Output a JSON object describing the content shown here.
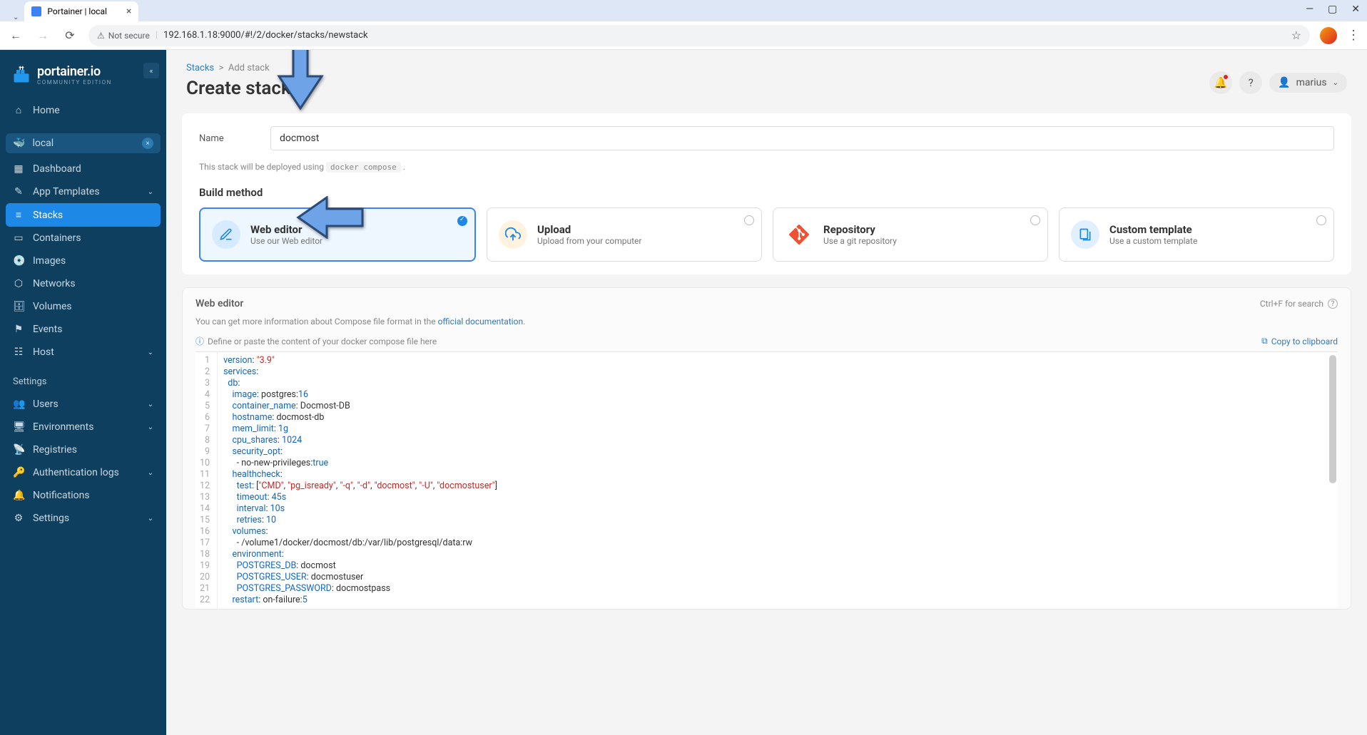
{
  "browser": {
    "tab_title": "Portainer | local",
    "security_label": "Not secure",
    "url": "192.168.1.18:9000/#!/2/docker/stacks/newstack"
  },
  "sidebar": {
    "logo": "portainer.io",
    "logo_sub": "COMMUNITY EDITION",
    "home": "Home",
    "env_label": "local",
    "items": [
      "Dashboard",
      "App Templates",
      "Stacks",
      "Containers",
      "Images",
      "Networks",
      "Volumes",
      "Events",
      "Host"
    ],
    "settings_label": "Settings",
    "settings_items": [
      "Users",
      "Environments",
      "Registries",
      "Authentication logs",
      "Notifications",
      "Settings"
    ]
  },
  "header": {
    "breadcrumb_root": "Stacks",
    "breadcrumb_current": "Add stack",
    "page_title": "Create stack",
    "username": "marius"
  },
  "form": {
    "name_label": "Name",
    "name_value": "docmost",
    "deploy_hint_prefix": "This stack will be deployed using ",
    "deploy_hint_code": "docker compose",
    "build_method_title": "Build method"
  },
  "methods": {
    "web": {
      "title": "Web editor",
      "sub": "Use our Web editor"
    },
    "upload": {
      "title": "Upload",
      "sub": "Upload from your computer"
    },
    "repo": {
      "title": "Repository",
      "sub": "Use a git repository"
    },
    "tmpl": {
      "title": "Custom template",
      "sub": "Use a custom template"
    }
  },
  "editor": {
    "title": "Web editor",
    "shortcut": "Ctrl+F for search",
    "hint_prefix": "You can get more information about Compose file format in the ",
    "hint_link": "official documentation",
    "info_text": "Define or paste the content of your docker compose file here",
    "copy_text": "Copy to clipboard"
  },
  "code_lines": [
    [
      [
        "key",
        "version"
      ],
      [
        "punc",
        ": "
      ],
      [
        "str",
        "\"3.9\""
      ]
    ],
    [
      [
        "key",
        "services"
      ],
      [
        "punc",
        ":"
      ]
    ],
    [
      [
        "plain",
        "  "
      ],
      [
        "key",
        "db"
      ],
      [
        "punc",
        ":"
      ]
    ],
    [
      [
        "plain",
        "    "
      ],
      [
        "key",
        "image"
      ],
      [
        "punc",
        ": postgres:"
      ],
      [
        "num",
        "16"
      ]
    ],
    [
      [
        "plain",
        "    "
      ],
      [
        "key",
        "container_name"
      ],
      [
        "punc",
        ": Docmost-DB"
      ]
    ],
    [
      [
        "plain",
        "    "
      ],
      [
        "key",
        "hostname"
      ],
      [
        "punc",
        ": docmost-db"
      ]
    ],
    [
      [
        "plain",
        "    "
      ],
      [
        "key",
        "mem_limit"
      ],
      [
        "punc",
        ": "
      ],
      [
        "num",
        "1g"
      ]
    ],
    [
      [
        "plain",
        "    "
      ],
      [
        "key",
        "cpu_shares"
      ],
      [
        "punc",
        ": "
      ],
      [
        "num",
        "1024"
      ]
    ],
    [
      [
        "plain",
        "    "
      ],
      [
        "key",
        "security_opt"
      ],
      [
        "punc",
        ":"
      ]
    ],
    [
      [
        "plain",
        "      - no-new-privileges:"
      ],
      [
        "key",
        "true"
      ]
    ],
    [
      [
        "plain",
        "    "
      ],
      [
        "key",
        "healthcheck"
      ],
      [
        "punc",
        ":"
      ]
    ],
    [
      [
        "plain",
        "      "
      ],
      [
        "key",
        "test"
      ],
      [
        "punc",
        ": ["
      ],
      [
        "str",
        "\"CMD\""
      ],
      [
        "punc",
        ", "
      ],
      [
        "str",
        "\"pg_isready\""
      ],
      [
        "punc",
        ", "
      ],
      [
        "str",
        "\"-q\""
      ],
      [
        "punc",
        ", "
      ],
      [
        "str",
        "\"-d\""
      ],
      [
        "punc",
        ", "
      ],
      [
        "str",
        "\"docmost\""
      ],
      [
        "punc",
        ", "
      ],
      [
        "str",
        "\"-U\""
      ],
      [
        "punc",
        ", "
      ],
      [
        "str",
        "\"docmostuser\""
      ],
      [
        "punc",
        "]"
      ]
    ],
    [
      [
        "plain",
        "      "
      ],
      [
        "key",
        "timeout"
      ],
      [
        "punc",
        ": "
      ],
      [
        "num",
        "45s"
      ]
    ],
    [
      [
        "plain",
        "      "
      ],
      [
        "key",
        "interval"
      ],
      [
        "punc",
        ": "
      ],
      [
        "num",
        "10s"
      ]
    ],
    [
      [
        "plain",
        "      "
      ],
      [
        "key",
        "retries"
      ],
      [
        "punc",
        ": "
      ],
      [
        "num",
        "10"
      ]
    ],
    [
      [
        "plain",
        "    "
      ],
      [
        "key",
        "volumes"
      ],
      [
        "punc",
        ":"
      ]
    ],
    [
      [
        "plain",
        "      - /volume1/docker/docmost/db:/var/lib/postgresql/data:rw"
      ]
    ],
    [
      [
        "plain",
        "    "
      ],
      [
        "key",
        "environment"
      ],
      [
        "punc",
        ":"
      ]
    ],
    [
      [
        "plain",
        "      "
      ],
      [
        "key",
        "POSTGRES_DB"
      ],
      [
        "punc",
        ": docmost"
      ]
    ],
    [
      [
        "plain",
        "      "
      ],
      [
        "key",
        "POSTGRES_USER"
      ],
      [
        "punc",
        ": docmostuser"
      ]
    ],
    [
      [
        "plain",
        "      "
      ],
      [
        "key",
        "POSTGRES_PASSWORD"
      ],
      [
        "punc",
        ": docmostpass"
      ]
    ],
    [
      [
        "plain",
        "    "
      ],
      [
        "key",
        "restart"
      ],
      [
        "punc",
        ": on-failure:"
      ],
      [
        "num",
        "5"
      ]
    ]
  ]
}
